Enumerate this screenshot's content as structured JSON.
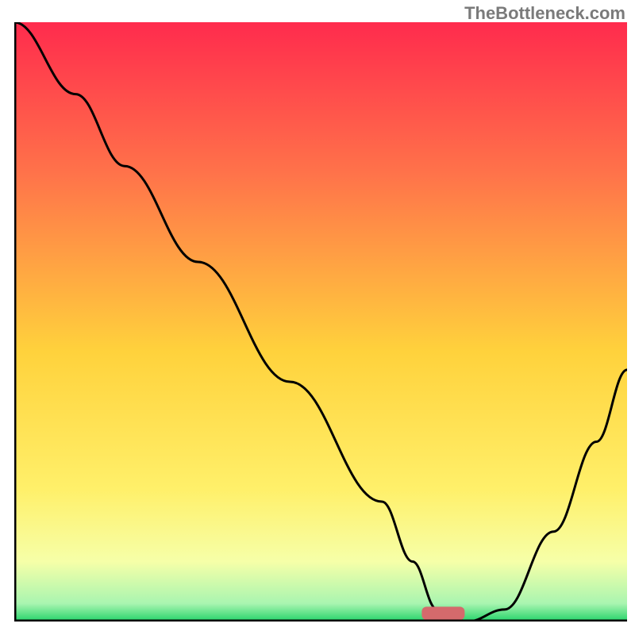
{
  "watermark": "TheBottleneck.com",
  "chart_data": {
    "type": "line",
    "title": "",
    "xlabel": "",
    "ylabel": "",
    "xlim": [
      0,
      100
    ],
    "ylim": [
      0,
      100
    ],
    "series": [
      {
        "name": "bottleneck-curve",
        "x": [
          0,
          10,
          18,
          30,
          45,
          60,
          65,
          69,
          74,
          80,
          88,
          95,
          100
        ],
        "y": [
          100,
          88,
          76,
          60,
          40,
          20,
          10,
          2,
          0,
          2,
          15,
          30,
          42
        ]
      }
    ],
    "marker": {
      "x_center": 70,
      "width": 7,
      "height": 2.2
    },
    "gradient_stops": [
      {
        "offset": 0,
        "color": "#ff2b4d"
      },
      {
        "offset": 25,
        "color": "#ff724a"
      },
      {
        "offset": 55,
        "color": "#ffd23c"
      },
      {
        "offset": 78,
        "color": "#fff06a"
      },
      {
        "offset": 90,
        "color": "#f6ffa8"
      },
      {
        "offset": 97,
        "color": "#a9f5b0"
      },
      {
        "offset": 100,
        "color": "#24d36a"
      }
    ]
  }
}
